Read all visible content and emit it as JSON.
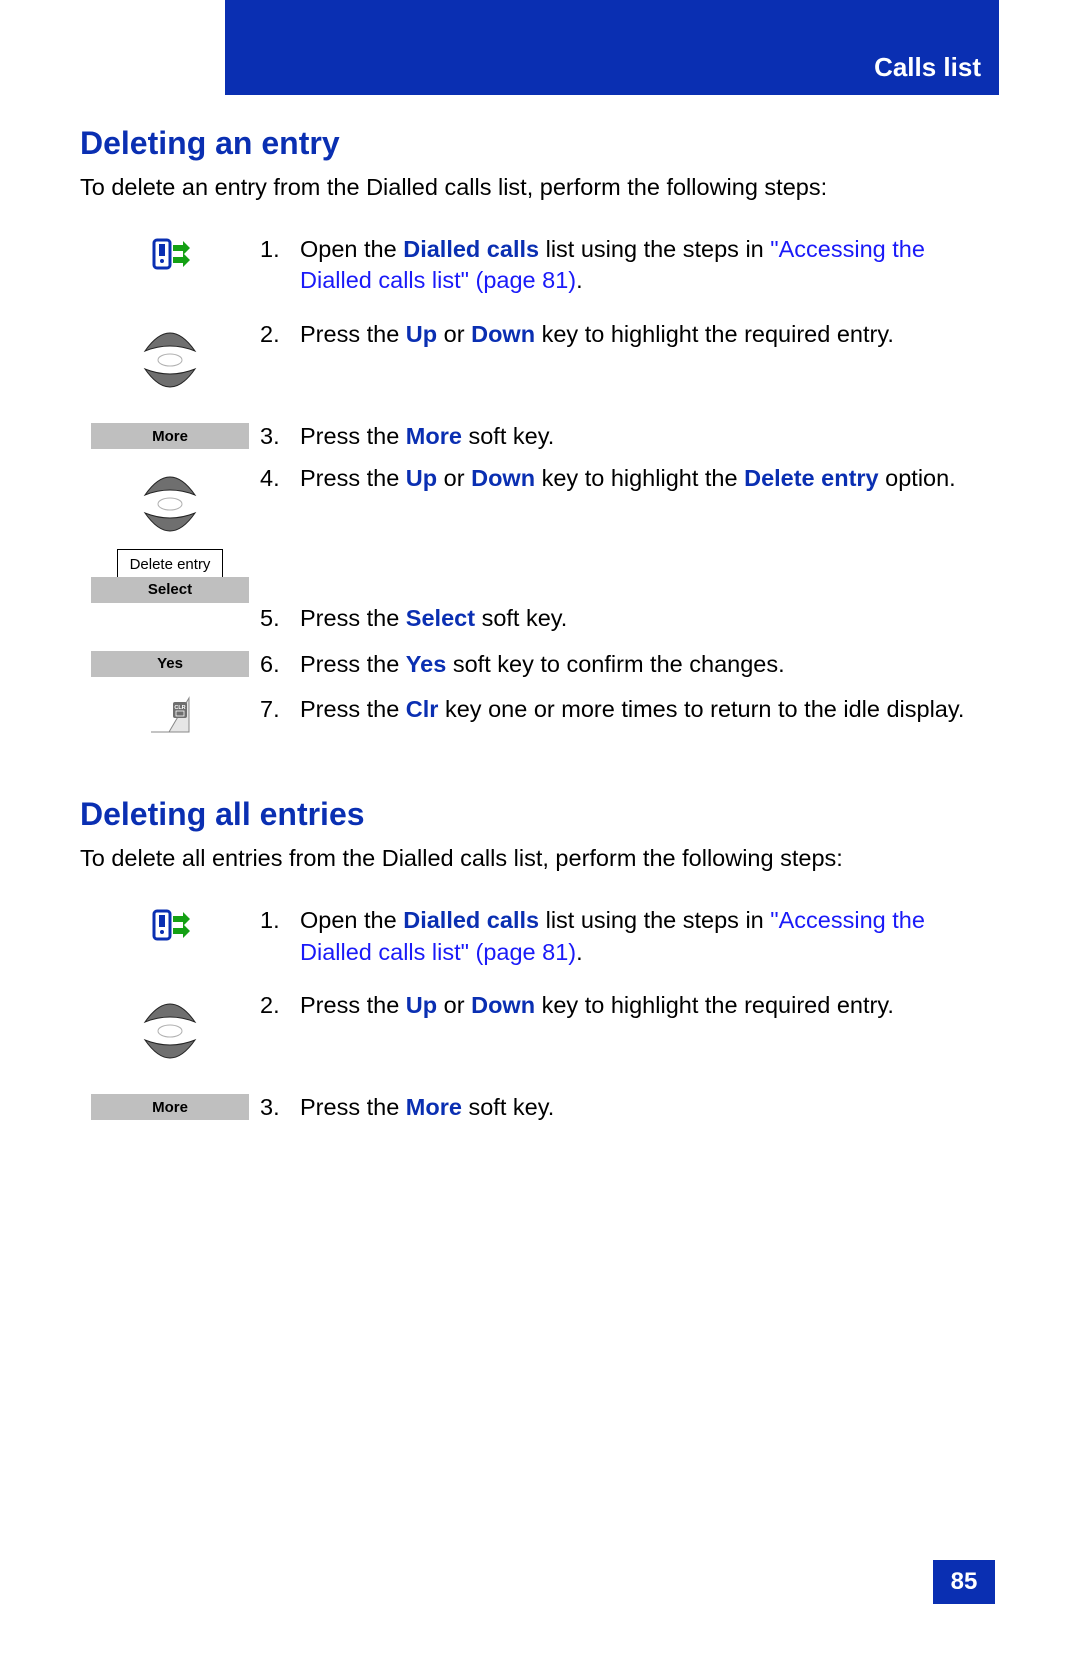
{
  "header": {
    "title": "Calls list"
  },
  "section1": {
    "heading": "Deleting an entry",
    "intro": "To delete an entry from the Dialled calls list, perform the following steps:",
    "steps": [
      {
        "num": "1.",
        "pre": "Open the ",
        "term": "Dialled calls",
        "post": " list using the steps in ",
        "link": "\"Accessing the Dialled calls list\" (page 81)",
        "tail": "."
      },
      {
        "num": "2.",
        "pre": "Press the ",
        "term": "Up",
        "mid": " or ",
        "term2": "Down",
        "post": " key to highlight the required entry."
      },
      {
        "num": "3.",
        "pre": "Press the ",
        "term": "More",
        "post": " soft key."
      },
      {
        "num": "4.",
        "pre": "Press the ",
        "term": "Up",
        "mid": " or ",
        "term2": "Down",
        "post": " key to highlight the ",
        "term3": "Delete entry",
        "tail": " option."
      },
      {
        "num": "5.",
        "pre": "Press the ",
        "term": "Select",
        "post": " soft key."
      },
      {
        "num": "6.",
        "pre": "Press the ",
        "term": "Yes",
        "post": " soft key to confirm the changes."
      },
      {
        "num": "7.",
        "pre": "Press the ",
        "term": "Clr",
        "post": " key one or more times to return to the idle display."
      }
    ],
    "softkeys": {
      "more": "More",
      "select": "Select",
      "yes": "Yes"
    },
    "menu_option": "Delete entry"
  },
  "section2": {
    "heading": "Deleting all entries",
    "intro": "To delete all entries from the Dialled calls list, perform the following steps:",
    "steps": [
      {
        "num": "1.",
        "pre": "Open the ",
        "term": "Dialled calls",
        "post": " list using the steps in ",
        "link": "\"Accessing the Dialled calls list\" (page 81)",
        "tail": "."
      },
      {
        "num": "2.",
        "pre": "Press the ",
        "term": "Up",
        "mid": " or ",
        "term2": "Down",
        "post": " key to highlight the required entry."
      },
      {
        "num": "3.",
        "pre": "Press the ",
        "term": "More",
        "post": " soft key."
      }
    ],
    "softkeys": {
      "more": "More"
    }
  },
  "page_number": "85"
}
